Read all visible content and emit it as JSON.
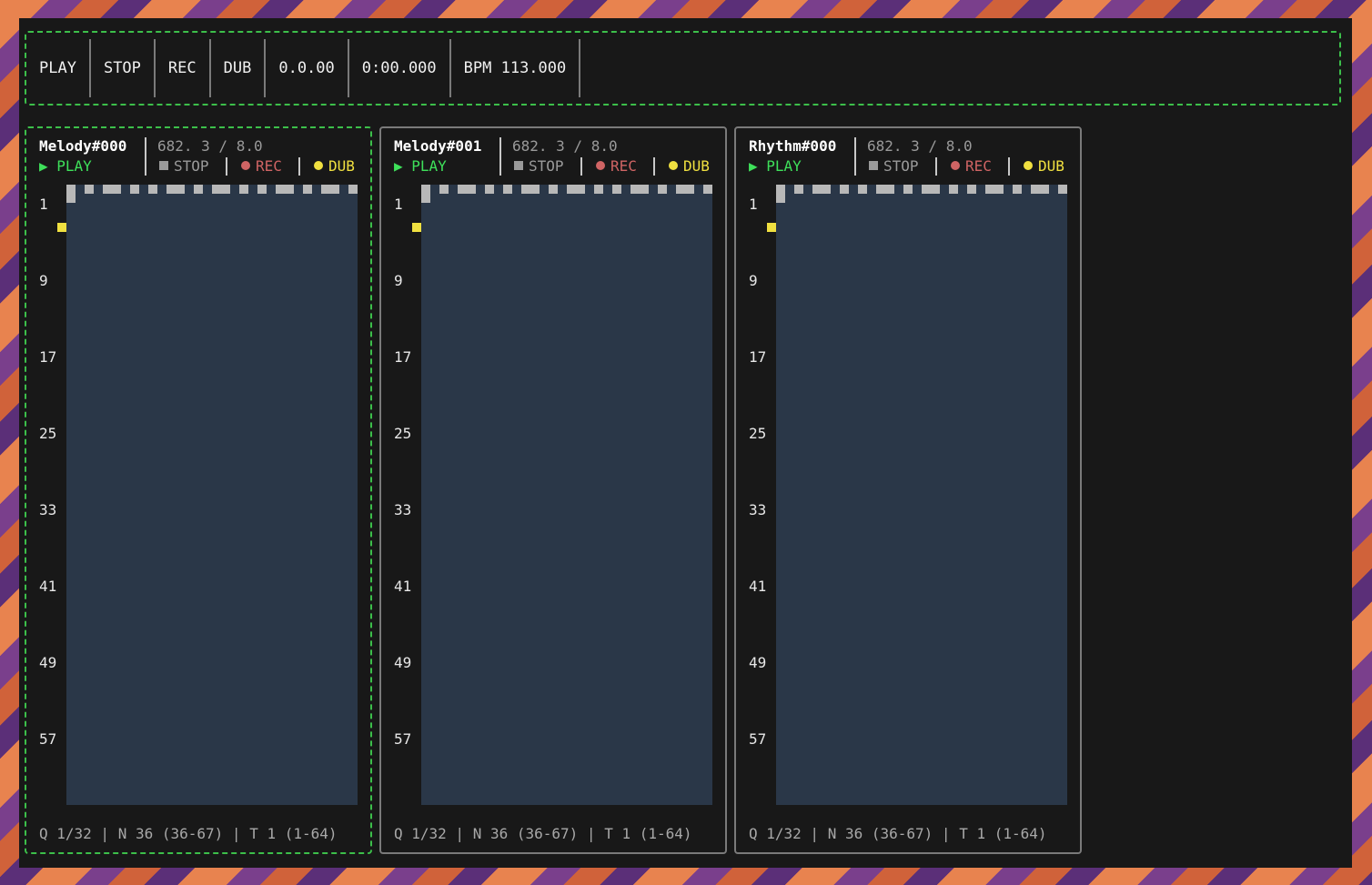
{
  "transport": {
    "play": "PLAY",
    "stop": "STOP",
    "rec": "REC",
    "dub": "DUB",
    "position": "0.0.00",
    "time": "0:00.000",
    "bpm": "BPM 113.000"
  },
  "row_labels": [
    "1",
    "9",
    "17",
    "25",
    "33",
    "41",
    "49",
    "57"
  ],
  "panels": [
    {
      "name": "Melody#000",
      "position": "682. 3 / 8.0",
      "play": "▶ PLAY",
      "stop": "STOP",
      "rec": "REC",
      "dub": "DUB",
      "footer": "Q 1/32 | N 36 (36-67) | T 1 (1-64)",
      "active": true
    },
    {
      "name": "Melody#001",
      "position": "682. 3 / 8.0",
      "play": "▶ PLAY",
      "stop": "STOP",
      "rec": "REC",
      "dub": "DUB",
      "footer": "Q 1/32 | N 36 (36-67) | T 1 (1-64)",
      "active": false
    },
    {
      "name": "Rhythm#000",
      "position": "682. 3 / 8.0",
      "play": "▶ PLAY",
      "stop": "STOP",
      "rec": "REC",
      "dub": "DUB",
      "footer": "Q 1/32 | N 36 (36-67) | T 1 (1-64)",
      "active": false
    }
  ],
  "colors": {
    "active_border": "#3cbf4a",
    "play": "#3ee05a",
    "rec": "#d06464",
    "dub": "#f0e040",
    "grid_bg": "#2a3748"
  }
}
